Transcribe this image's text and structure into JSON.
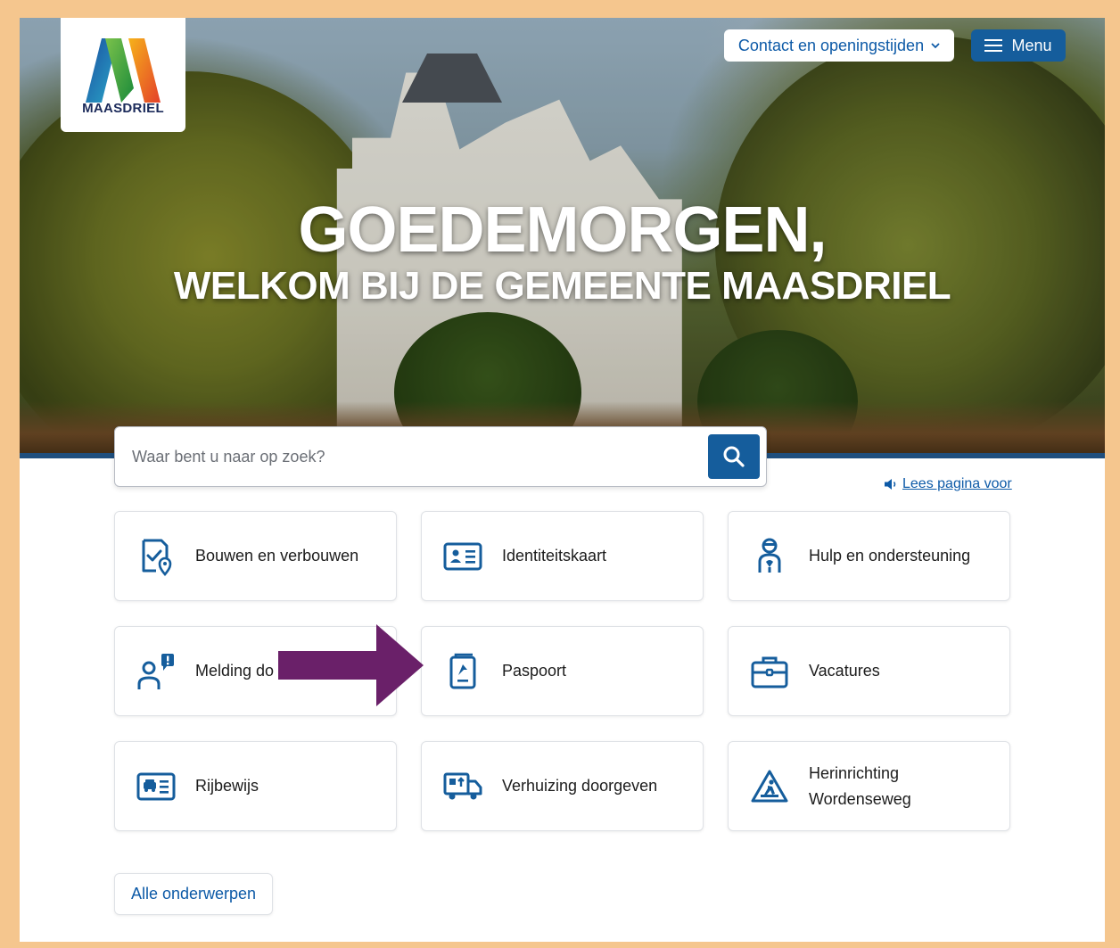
{
  "header": {
    "logo_text": "MAASDRIEL",
    "contact_label": "Contact en openingstijden",
    "menu_label": "Menu"
  },
  "hero": {
    "greeting": "GOEDEMORGEN,",
    "welcome": "WELKOM BIJ DE GEMEENTE MAASDRIEL"
  },
  "search": {
    "placeholder": "Waar bent u naar op zoek?"
  },
  "read_aloud": {
    "label": "Lees pagina voor"
  },
  "topics": [
    {
      "label": "Bouwen en verbouwen",
      "icon": "building-permit-icon"
    },
    {
      "label": "Identiteitskaart",
      "icon": "id-card-icon"
    },
    {
      "label": "Hulp en ondersteuning",
      "icon": "support-person-icon"
    },
    {
      "label": "Melding do",
      "icon": "report-person-icon"
    },
    {
      "label": "Paspoort",
      "icon": "passport-icon"
    },
    {
      "label": "Vacatures",
      "icon": "briefcase-icon"
    },
    {
      "label": "Rijbewijs",
      "icon": "drivers-license-icon"
    },
    {
      "label": "Verhuizing doorgeven",
      "icon": "moving-truck-icon"
    },
    {
      "label_line1": "Herinrichting",
      "label_line2": "Wordenseweg",
      "icon": "road-works-icon"
    }
  ],
  "all_topics_label": "Alle onderwerpen",
  "colors": {
    "primary": "#155d9c",
    "link": "#0d5aa7",
    "frame": "#f5c68e",
    "annotation_arrow": "#6a2069"
  }
}
